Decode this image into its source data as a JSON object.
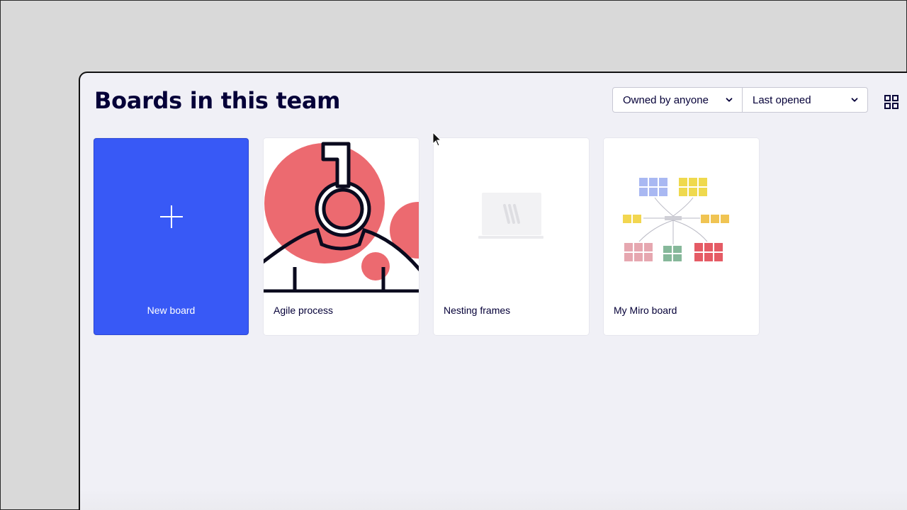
{
  "header": {
    "title": "Boards in this team"
  },
  "filters": {
    "owner": "Owned by anyone",
    "sort": "Last opened"
  },
  "boards": [
    {
      "label": "New board"
    },
    {
      "label": "Agile process"
    },
    {
      "label": "Nesting frames"
    },
    {
      "label": "My Miro board"
    }
  ],
  "colors": {
    "accent": "#3859f6",
    "agile_red": "#ec6a70",
    "text": "#050038"
  },
  "icons": {
    "view_toggle": "grid-view-icon",
    "new_board": "plus-icon",
    "dropdown": "chevron-down-icon"
  }
}
